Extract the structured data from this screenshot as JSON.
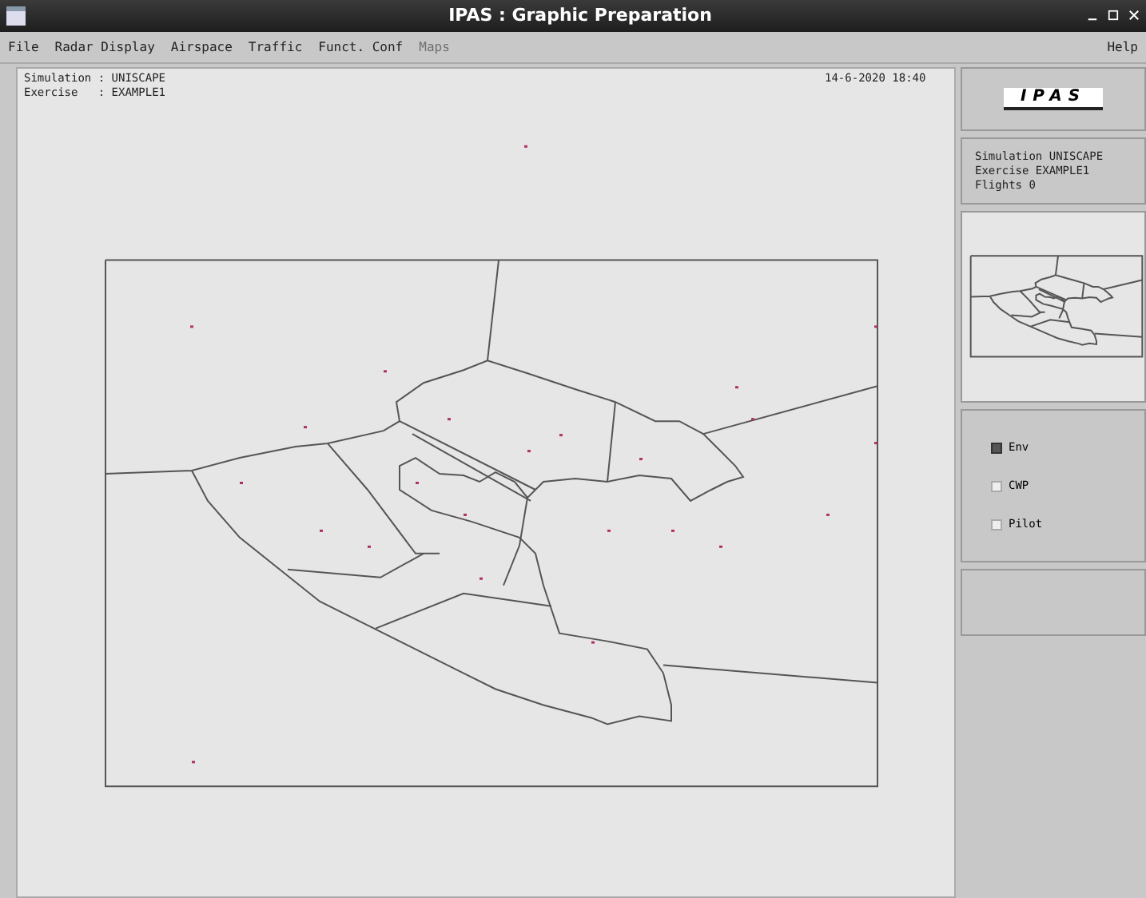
{
  "window": {
    "title": "IPAS : Graphic Preparation"
  },
  "menu": [
    {
      "label": "File",
      "disabled": false
    },
    {
      "label": "Radar Display",
      "disabled": false
    },
    {
      "label": "Airspace",
      "disabled": false
    },
    {
      "label": "Traffic",
      "disabled": false
    },
    {
      "label": "Funct. Conf",
      "disabled": false
    },
    {
      "label": "Maps",
      "disabled": true
    }
  ],
  "help": "Help",
  "canvas": {
    "info_lines": [
      "Simulation : UNISCAPE",
      "Exercise   : EXAMPLE1"
    ],
    "datetime": "14-6-2020 18:40"
  },
  "logo": "IPAS",
  "info_panel": [
    "Simulation UNISCAPE",
    "Exercise EXAMPLE1",
    "Flights 0"
  ],
  "options": [
    {
      "label": "Env",
      "checked": true
    },
    {
      "label": "CWP",
      "checked": false
    },
    {
      "label": "Pilot",
      "checked": false
    }
  ]
}
